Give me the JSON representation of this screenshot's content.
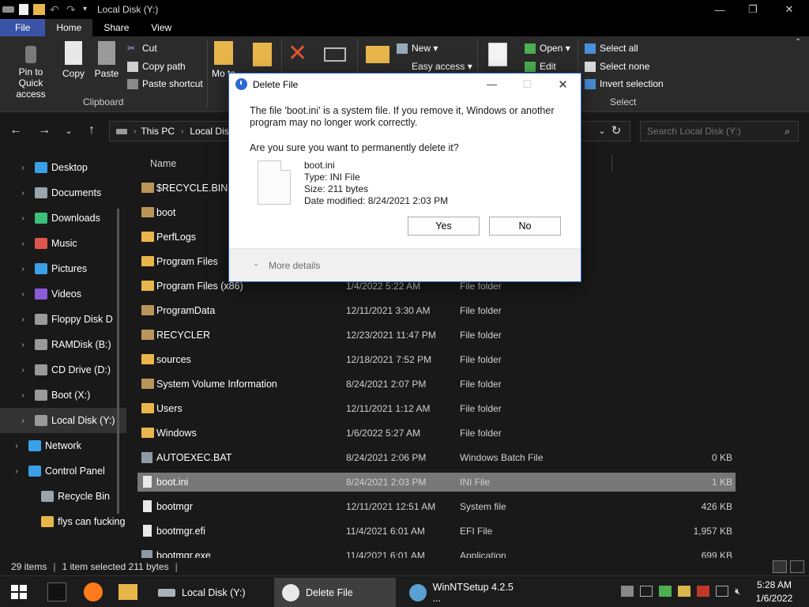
{
  "window": {
    "title": "Local Disk (Y:)",
    "controls": {
      "minimize": "—",
      "maximize": "❐",
      "close": "✕"
    }
  },
  "ribbon_tabs": [
    "File",
    "Home",
    "Share",
    "View"
  ],
  "ribbon": {
    "clipboard": {
      "pin": "Pin to Quick access",
      "copy": "Copy",
      "paste": "Paste",
      "cut": "Cut",
      "copy_path": "Copy path",
      "paste_shortcut": "Paste shortcut",
      "group": "Clipboard"
    },
    "organize": {
      "move_to": "Mo to"
    },
    "new": {
      "new_item": "New ▾",
      "easy_access": "Easy access ▾"
    },
    "open": {
      "open": "Open ▾",
      "edit": "Edit"
    },
    "select": {
      "select_all": "Select all",
      "select_none": "Select none",
      "invert": "Invert selection",
      "group": "Select"
    }
  },
  "address": {
    "crumbs": [
      "This PC",
      "Local Dis"
    ],
    "search_placeholder": "Search Local Disk (Y:)"
  },
  "nav_pane": [
    {
      "label": "Desktop",
      "color": "#3aa0e8"
    },
    {
      "label": "Documents",
      "color": "#9aa5ad"
    },
    {
      "label": "Downloads",
      "color": "#3bbf7a"
    },
    {
      "label": "Music",
      "color": "#e0564e"
    },
    {
      "label": "Pictures",
      "color": "#3aa0e8"
    },
    {
      "label": "Videos",
      "color": "#8a5ad8"
    },
    {
      "label": "Floppy Disk D",
      "color": "#9a9a9a"
    },
    {
      "label": "RAMDisk (B:)",
      "color": "#9a9a9a"
    },
    {
      "label": "CD Drive (D:)",
      "color": "#9a9a9a"
    },
    {
      "label": "Boot (X:)",
      "color": "#9a9a9a"
    },
    {
      "label": "Local Disk (Y:)",
      "color": "#9a9a9a"
    },
    {
      "label": "Network",
      "color": "#3aa0e8"
    },
    {
      "label": "Control Panel",
      "color": "#3aa0e8"
    },
    {
      "label": "Recycle Bin",
      "color": "#9aa5ad"
    },
    {
      "label": "flys can fucking",
      "color": "#e8b64a"
    }
  ],
  "columns": {
    "name": "Name"
  },
  "files": [
    {
      "name": "$RECYCLE.BIN",
      "date": "",
      "type": "",
      "size": "",
      "icon": "folder-dim"
    },
    {
      "name": "boot",
      "date": "",
      "type": "",
      "size": "",
      "icon": "folder-dim"
    },
    {
      "name": "PerfLogs",
      "date": "",
      "type": "",
      "size": "",
      "icon": "folder"
    },
    {
      "name": "Program Files",
      "date": "",
      "type": "",
      "size": "",
      "icon": "folder"
    },
    {
      "name": "Program Files (x86)",
      "date": "1/4/2022 5:22 AM",
      "type": "File folder",
      "size": "",
      "icon": "folder"
    },
    {
      "name": "ProgramData",
      "date": "12/11/2021 3:30 AM",
      "type": "File folder",
      "size": "",
      "icon": "folder-dim"
    },
    {
      "name": "RECYCLER",
      "date": "12/23/2021 11:47 PM",
      "type": "File folder",
      "size": "",
      "icon": "folder-dim"
    },
    {
      "name": "sources",
      "date": "12/18/2021 7:52 PM",
      "type": "File folder",
      "size": "",
      "icon": "folder"
    },
    {
      "name": "System Volume Information",
      "date": "8/24/2021 2:07 PM",
      "type": "File folder",
      "size": "",
      "icon": "folder-dim"
    },
    {
      "name": "Users",
      "date": "12/11/2021 1:12 AM",
      "type": "File folder",
      "size": "",
      "icon": "folder"
    },
    {
      "name": "Windows",
      "date": "1/6/2022 5:27 AM",
      "type": "File folder",
      "size": "",
      "icon": "folder"
    },
    {
      "name": "AUTOEXEC.BAT",
      "date": "8/24/2021 2:06 PM",
      "type": "Windows Batch File",
      "size": "0 KB",
      "icon": "bat"
    },
    {
      "name": "boot.ini",
      "date": "8/24/2021 2:03 PM",
      "type": "INI File",
      "size": "1 KB",
      "icon": "file",
      "selected": true
    },
    {
      "name": "bootmgr",
      "date": "12/11/2021 12:51 AM",
      "type": "System file",
      "size": "426 KB",
      "icon": "file"
    },
    {
      "name": "bootmgr.efi",
      "date": "11/4/2021 6:01 AM",
      "type": "EFI File",
      "size": "1,957 KB",
      "icon": "file"
    },
    {
      "name": "bootmgr.exe",
      "date": "11/4/2021 6:01 AM",
      "type": "Application",
      "size": "699 KB",
      "icon": "bat"
    }
  ],
  "status": {
    "items": "29 items",
    "selected": "1 item selected  211 bytes"
  },
  "taskbar": {
    "tasks": [
      {
        "label": "Local Disk (Y:)",
        "color": "#aab2b8"
      },
      {
        "label": "Delete File",
        "color": "#e8e8e8"
      },
      {
        "label": "WinNTSetup 4.2.5 ...",
        "color": "#5aa0d0"
      }
    ],
    "time": "5:28 AM",
    "date": "1/6/2022"
  },
  "dialog": {
    "title": "Delete File",
    "message": "The file 'boot.ini' is a system file. If you remove it, Windows or another program may no longer work correctly.",
    "question": "Are you sure you want to permanently delete it?",
    "file_name": "boot.ini",
    "file_type": "Type: INI File",
    "file_size": "Size: 211 bytes",
    "file_modified": "Date modified: 8/24/2021 2:03 PM",
    "yes": "Yes",
    "no": "No",
    "more_details": "More details"
  }
}
